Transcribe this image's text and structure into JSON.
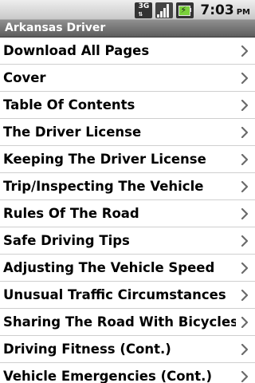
{
  "status_bar": {
    "network_label": "3G",
    "time": "7:03",
    "ampm": "PM",
    "icons": [
      "3g-icon",
      "signal-icon",
      "battery-icon"
    ]
  },
  "title_bar": {
    "title": "Arkansas Driver"
  },
  "list": {
    "items": [
      {
        "label": "Download All Pages"
      },
      {
        "label": "Cover"
      },
      {
        "label": "Table Of Contents"
      },
      {
        "label": "The Driver License"
      },
      {
        "label": "Keeping The Driver License"
      },
      {
        "label": "Trip/Inspecting The Vehicle"
      },
      {
        "label": "Rules Of The Road"
      },
      {
        "label": "Safe Driving Tips"
      },
      {
        "label": "Adjusting The Vehicle Speed"
      },
      {
        "label": "Unusual Traffic Circumstances"
      },
      {
        "label": "Sharing The Road With Bicycles"
      },
      {
        "label": "Driving Fitness (Cont.)"
      },
      {
        "label": "Vehicle Emergencies (Cont.)"
      }
    ]
  }
}
